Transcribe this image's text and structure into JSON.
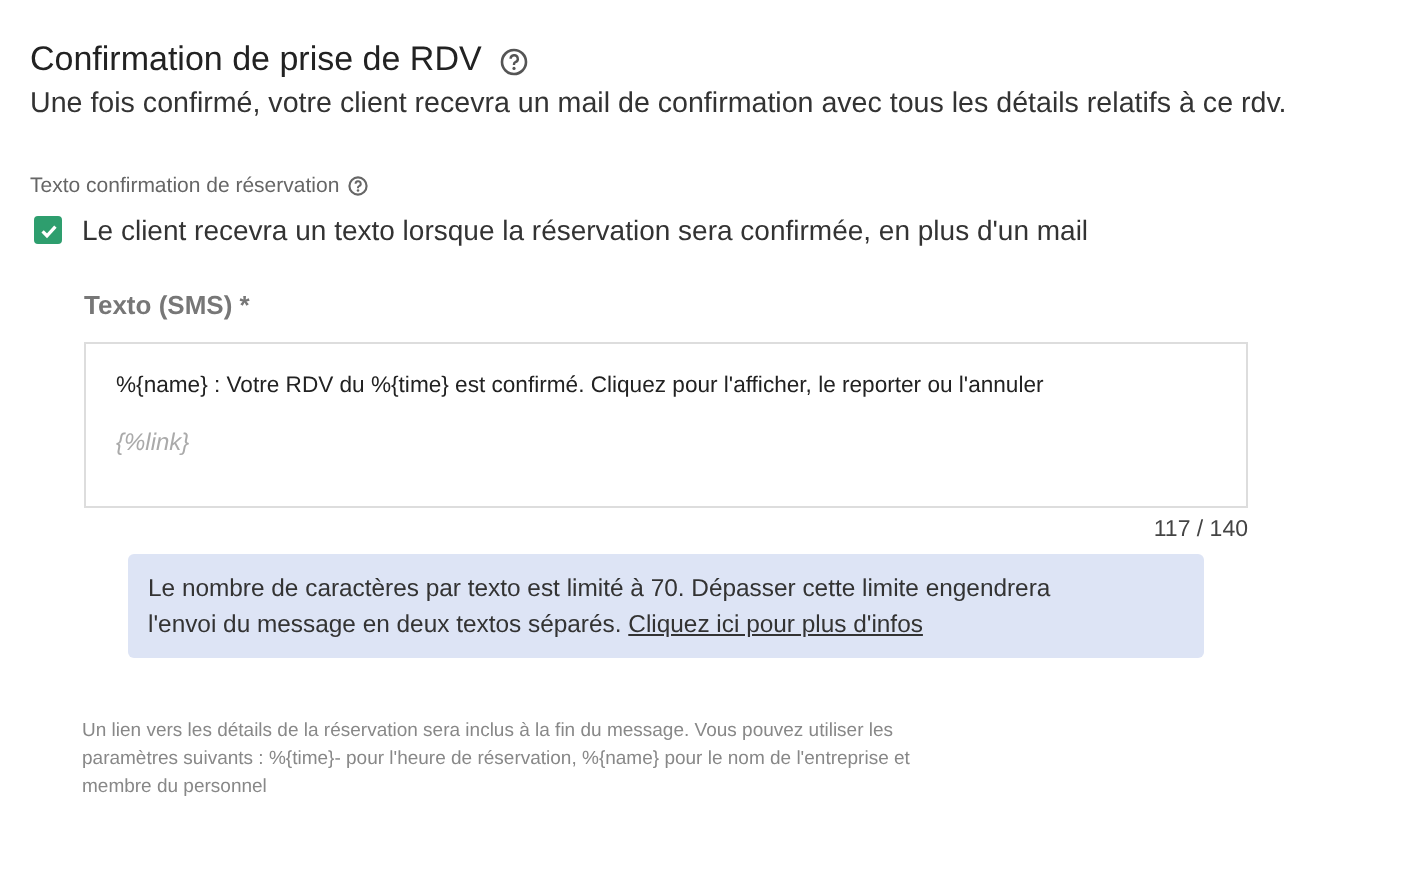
{
  "section": {
    "title": "Confirmation de prise de RDV",
    "description": "Une fois confirmé, votre client recevra un mail de confirmation avec tous les détails relatifs à ce rdv."
  },
  "sms_setting": {
    "label": "Texto confirmation de réservation",
    "checkbox": {
      "label": "Le client recevra un texto lorsque la réservation sera confirmée, en plus d'un mail",
      "checked": true
    }
  },
  "sms_field": {
    "label": "Texto (SMS) *",
    "value": "%{name} : Votre RDV du %{time} est confirmé. Cliquez pour l'afficher, le reporter ou l'annuler",
    "link_token": "{%link}",
    "counter": "117 / 140"
  },
  "info_box": {
    "text": "Le nombre de caractères par texto est limité à 70. Dépasser cette limite engendrera l'envoi du message en deux textos séparés.",
    "link": "Cliquez ici pour plus d'infos"
  },
  "footnote": "Un lien vers les détails de la réservation sera inclus à la fin du message. Vous pouvez utiliser les paramètres suivants : %{time}- pour l'heure de réservation, %{name} pour le nom de l'entreprise et membre du personnel"
}
